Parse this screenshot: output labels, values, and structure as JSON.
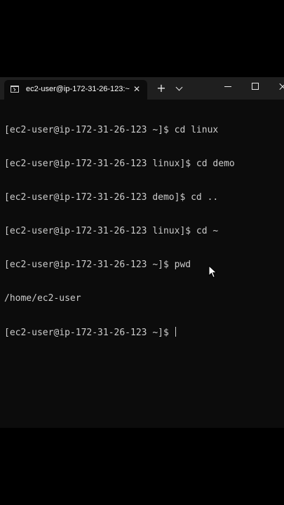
{
  "window": {
    "tab_title": "ec2-user@ip-172-31-26-123:~",
    "tab_icon": "terminal-icon",
    "new_tab": "+",
    "close_tab": "✕"
  },
  "terminal": {
    "lines": [
      "[ec2-user@ip-172-31-26-123 ~]$ cd linux",
      "[ec2-user@ip-172-31-26-123 linux]$ cd demo",
      "[ec2-user@ip-172-31-26-123 demo]$ cd ..",
      "[ec2-user@ip-172-31-26-123 linux]$ cd ~",
      "[ec2-user@ip-172-31-26-123 ~]$ pwd",
      "/home/ec2-user"
    ],
    "prompt": "[ec2-user@ip-172-31-26-123 ~]$ "
  },
  "colors": {
    "background": "#0c0c0c",
    "titlebar": "#1f1f1f",
    "text": "#cccccc"
  }
}
